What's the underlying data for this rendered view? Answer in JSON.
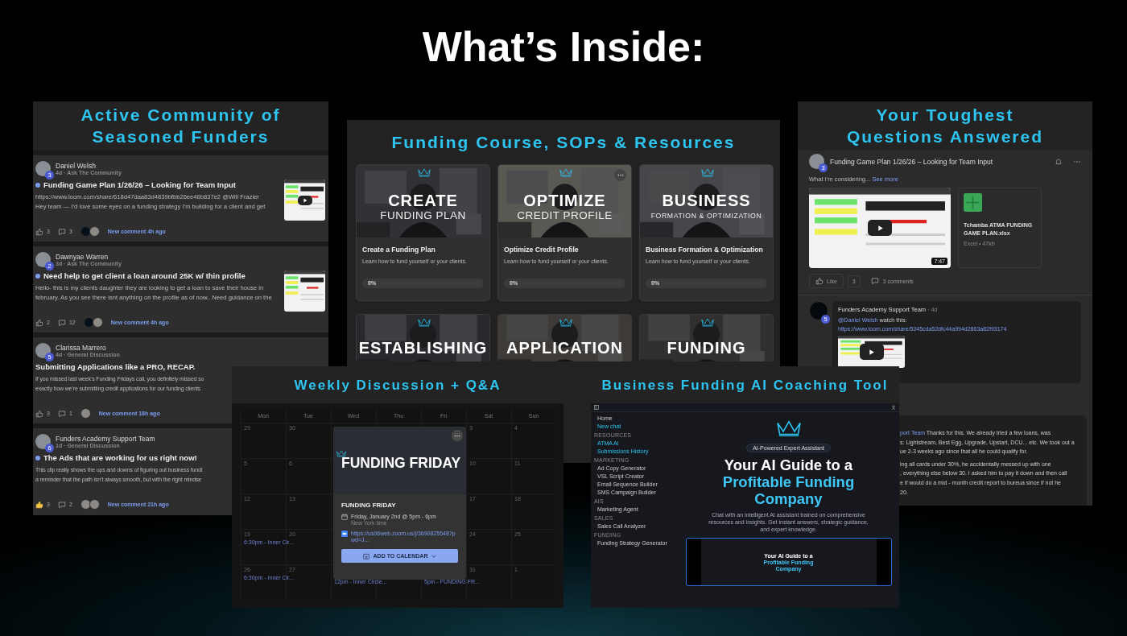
{
  "page_title": "What’s Inside:",
  "community": {
    "title_lines": [
      "Active Community of",
      "Seasoned Funders"
    ],
    "posts": [
      {
        "author": "Daniel Welsh",
        "level": "3",
        "meta": "4d · Ask The Community",
        "unread": true,
        "title": "Funding Game Plan 1/26/26 – Looking for Team Input",
        "body": [
          "https://www.loom.com/share/618d47daa83d4839bfbb26ee46b837e2 @Will Frazier",
          "Hey team — I’d love some eyes on a funding strategy I’m building for a client and get"
        ],
        "liked": false,
        "likes": "3",
        "comments": "3",
        "commenters": [
          {
            "kind": "logo"
          },
          {
            "kind": "person"
          }
        ],
        "activity": "New comment 4h ago",
        "thumbnail": {
          "kind": "picture",
          "video": true
        }
      },
      {
        "author": "Dawnyae Warren",
        "level": "2",
        "meta": "3d · Ask The Community",
        "unread": true,
        "title": "Need help to get client a loan around 25K w/ thin profile",
        "body": [
          "Hello- this is my clients daughter they are looking to get a loan to save their house in",
          "february. As you see there isnt anything on the profile as of now.. Need guidance on the"
        ],
        "liked": false,
        "likes": "2",
        "comments": "12",
        "commenters": [
          {
            "kind": "logo"
          },
          {
            "kind": "person"
          }
        ],
        "activity": "New comment 4h ago",
        "thumbnail": {
          "kind": "picture",
          "video": false
        }
      },
      {
        "author": "Clarissa Marrero",
        "level": "5",
        "meta": "4d · General Discussion",
        "unread": false,
        "title": "Submitting Applications like a PRO, RECAP.",
        "body": [
          "If you missed last week’s Funding Fridays call, you definitely missed so",
          "exactly how we’re submitting credit applications for our funding clients"
        ],
        "liked": false,
        "likes": "3",
        "comments": "1",
        "commenters": [
          {
            "kind": "person"
          }
        ],
        "activity": "New comment 18h ago"
      },
      {
        "author": "Funders Academy Support Team",
        "level": "6",
        "meta": "1d · General Discussion",
        "unread": true,
        "title": "The Ads that are working for us right now!",
        "body": [
          "This clip really shows the ups and downs of figuring out business fundi",
          "a reminder that the path isn’t always smooth, but with the right mindse"
        ],
        "liked": true,
        "likes": "3",
        "comments": "2",
        "commenters": [
          {
            "kind": "person"
          },
          {
            "kind": "person"
          }
        ],
        "activity": "New comment 21h ago"
      }
    ]
  },
  "course": {
    "title": "Funding Course, SOPs & Resources",
    "modules": [
      {
        "headline": "CREATE",
        "subline": "FUNDING PLAN",
        "title": "Create a Funding Plan",
        "description": "Learn how to fund yourself or your clients.",
        "progress": "0%",
        "level": 0,
        "menu": false
      },
      {
        "headline": "OPTIMIZE",
        "subline": "CREDIT PROFILE",
        "title": "Optimize Credit Profile",
        "description": "Learn how to fund yourself or your clients.",
        "progress": "0%",
        "level": 0,
        "menu": true
      },
      {
        "headline": "BUSINESS",
        "subline": "FORMATION & OPTIMIZATION",
        "title": "Business Formation & Optimization",
        "description": "Learn how to fund yourself or your clients.",
        "progress": "0%",
        "level": 0,
        "menu": false
      },
      {
        "headline": "ESTABLISHING",
        "menu": false
      },
      {
        "headline": "APPLICATION",
        "menu": false
      },
      {
        "headline": "FUNDING",
        "menu": false
      }
    ]
  },
  "qa": {
    "title_lines": [
      "Your Toughest",
      "Questions Answered"
    ],
    "post": {
      "level": "3",
      "title": "Funding Game Plan 1/26/26 – Looking for Team Input",
      "excerpt": "What I’m considering...",
      "see_more": "See more",
      "duration": "7:47",
      "file_name_lines": [
        "Tchamba ATMA FUNDING",
        "GAME PLAN.xlsx"
      ],
      "file_meta": "Excel • 47kb",
      "like_label": "Like",
      "likes": "3",
      "comments": "3 comments"
    },
    "reply": {
      "author": "Funders Academy Support Team",
      "level": "5",
      "age": "· 4d",
      "mention": "@Daniel Welsh",
      "text": "watch this:",
      "url": "https://www.loom.com/share/5345cda52dfc44a994d2863a82f93174"
    },
    "answer": {
      "mention": "port Team",
      "first_line": "Thanks for this. We already tried a few loans, was",
      "lines": [
        "s: Lightstream, Best Egg, Upgrade, Upstart, DCU... etc. We took out a",
        "ue 2-3 weeks ago since that all he could qualify for."
      ],
      "lines_2": [
        "ing all cards under 30%, he accidentally messed up with one",
        ", everything else below 30. I asked him to pay it down and then call",
        "e if would do a mid - month credit report to bureua since if not he",
        "20."
      ]
    }
  },
  "calendar": {
    "title": "Weekly Discussion + Q&A",
    "weekdays": [
      "Mon",
      "Tue",
      "Wed",
      "Thu",
      "Fri",
      "Sat",
      "Sun"
    ],
    "weeks": [
      {
        "mon": {
          "date": "29"
        },
        "tue": {
          "date": "30"
        },
        "sat": {
          "date": "3"
        },
        "sun": {
          "date": "4"
        }
      },
      {
        "mon": {
          "date": "5"
        },
        "tue": {
          "date": "6"
        },
        "sat": {
          "date": "10"
        },
        "sun": {
          "date": "11"
        }
      },
      {
        "mon": {
          "date": "12"
        },
        "tue": {
          "date": "13"
        },
        "sat": {
          "date": "17"
        },
        "sun": {
          "date": "18"
        }
      },
      {
        "mon": {
          "date": "19",
          "event": "6:30pm - Inner Cir..."
        },
        "tue": {
          "date": "20"
        },
        "sat": {
          "date": "24"
        },
        "sun": {
          "date": "25"
        }
      },
      {
        "mon": {
          "date": "26",
          "event": "6:30pm - Inner Cir..."
        },
        "tue": {
          "date": "27"
        },
        "wed": {
          "event": "12pm - Inner Circle..."
        },
        "fri": {
          "event": "5pm - FUNDING FR..."
        },
        "sat": {
          "date": "31"
        },
        "sun": {
          "date": "1"
        }
      }
    ],
    "event": {
      "banner": "FUNDING FRIDAY",
      "title": "FUNDING FRIDAY",
      "when": "Friday, January 2nd @ 5pm - 6pm",
      "timezone": "New York time",
      "link": "https://us06web.zoom.us/j/3690825548?pwd=J...",
      "button": "ADD TO CALENDAR"
    }
  },
  "ai_tool": {
    "title": "Business Funding AI Coaching Tool",
    "sidebar": [
      {
        "kind": "item",
        "label": "Home",
        "active": false
      },
      {
        "kind": "item",
        "label": "New chat",
        "active": true
      },
      {
        "kind": "section",
        "label": "RESOURCES"
      },
      {
        "kind": "item",
        "label": "ATMA AI",
        "active": true
      },
      {
        "kind": "item",
        "label": "Submissions History",
        "active": true
      },
      {
        "kind": "section",
        "label": "MARKETING"
      },
      {
        "kind": "item",
        "label": "Ad Copy Generator",
        "active": false
      },
      {
        "kind": "item",
        "label": "VSL Script Creator",
        "active": false
      },
      {
        "kind": "item",
        "label": "Email Sequence Builder",
        "active": false
      },
      {
        "kind": "item",
        "label": "SMS Campaign Builder",
        "active": false
      },
      {
        "kind": "section",
        "label": "AIS"
      },
      {
        "kind": "item",
        "label": "Marketing Agent",
        "active": false
      },
      {
        "kind": "section",
        "label": "SALES"
      },
      {
        "kind": "item",
        "label": "Sales Call Analyzer",
        "active": false
      },
      {
        "kind": "section",
        "label": "FUNDING"
      },
      {
        "kind": "item",
        "label": "Funding Strategy Generator",
        "active": false
      }
    ],
    "badge": "AI-Powered Expert Assistant",
    "heading": "Your AI Guide to a",
    "heading_accent_lines": [
      "Profitable Funding",
      "Company"
    ],
    "description_lines": [
      "Chat with an intelligent AI assistant trained on comprehensive",
      "resources and insights. Get instant answers, strategic guidance,",
      "and expert knowledge."
    ],
    "preview": {
      "heading": "Your AI Guide to a",
      "accent_lines": [
        "Profitable Funding",
        "Company"
      ]
    }
  }
}
